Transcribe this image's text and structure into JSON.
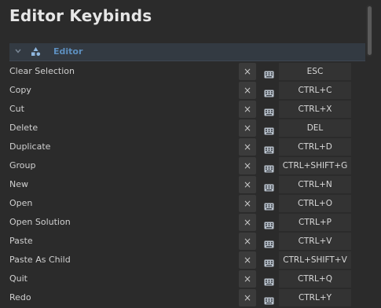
{
  "title": "Editor Keybinds",
  "section": {
    "label": "Editor",
    "icon": "shapes-icon",
    "label_color": "#5d8fbf"
  },
  "clear_icon": "×",
  "keybinds": [
    {
      "label": "Clear Selection",
      "shortcut": "ESC"
    },
    {
      "label": "Copy",
      "shortcut": "CTRL+C"
    },
    {
      "label": "Cut",
      "shortcut": "CTRL+X"
    },
    {
      "label": "Delete",
      "shortcut": "DEL"
    },
    {
      "label": "Duplicate",
      "shortcut": "CTRL+D"
    },
    {
      "label": "Group",
      "shortcut": "CTRL+SHIFT+G"
    },
    {
      "label": "New",
      "shortcut": "CTRL+N"
    },
    {
      "label": "Open",
      "shortcut": "CTRL+O"
    },
    {
      "label": "Open Solution",
      "shortcut": "CTRL+P"
    },
    {
      "label": "Paste",
      "shortcut": "CTRL+V"
    },
    {
      "label": "Paste As Child",
      "shortcut": "CTRL+SHIFT+V"
    },
    {
      "label": "Quit",
      "shortcut": "CTRL+Q"
    },
    {
      "label": "Redo",
      "shortcut": "CTRL+Y"
    }
  ]
}
